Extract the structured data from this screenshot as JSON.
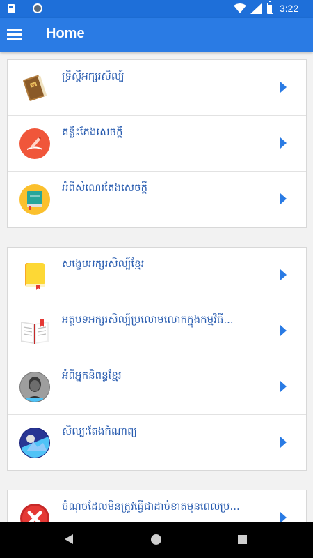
{
  "status_bar": {
    "time": "3:22",
    "icons": [
      "sd-card-icon",
      "app-circle-icon",
      "wifi-icon",
      "signal-icon",
      "battery-charging-icon"
    ]
  },
  "app_bar": {
    "title": "Home",
    "menu_icon": "menu-icon"
  },
  "sections": [
    {
      "items": [
        {
          "label": "ទ្រឹស្តីអក្សរសិល្ប៍",
          "icon": "book-icon"
        },
        {
          "label": "គន្លឹះតែងសេចក្តី",
          "icon": "writing-icon"
        },
        {
          "label": "អំពីសំណេរតែងសេចក្តី",
          "icon": "notebook-icon"
        }
      ]
    },
    {
      "items": [
        {
          "label": "សង្ខេបអក្សរសិល្ប៍ខ្មែរ",
          "icon": "closed-book-icon"
        },
        {
          "label": "អត្ថបទអក្សរសិល្ប៍ប្រលោមលោកក្នុងកម្មវិធី...",
          "icon": "open-book-icon"
        },
        {
          "label": "អំពីអ្នកនិពន្ធខ្មែរ",
          "icon": "author-photo-icon"
        },
        {
          "label": "សិល្បៈតែងកំណាព្យ",
          "icon": "poetry-art-icon"
        }
      ]
    },
    {
      "items": [
        {
          "label": "ចំណុចដែលមិនត្រូវធ្វើជាដាច់ខាតមុនពេលប្រ...",
          "icon": "red-x-icon"
        }
      ]
    }
  ],
  "colors": {
    "status_bar": "#1e6fd9",
    "app_bar": "#2a7be4",
    "label_text": "#2a5db0",
    "arrow": "#2a7be4"
  },
  "nav_bar": {
    "icons": [
      "back-icon",
      "home-icon",
      "recents-icon"
    ]
  }
}
